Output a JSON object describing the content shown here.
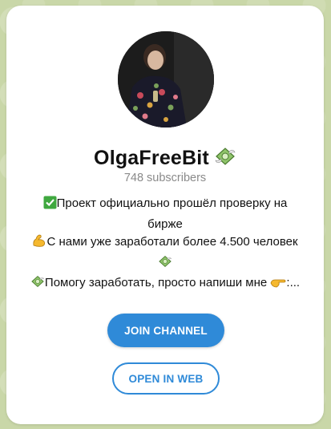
{
  "channel": {
    "name": "OlgaFreeBit",
    "name_emoji_icon": "money-with-wings-icon",
    "subscribers": "748 subscribers",
    "description": {
      "line1_emoji": "check-mark-icon",
      "line1": "Проект официально прошёл проверку на",
      "line2": "бирже",
      "line3_emoji": "flexed-biceps-icon",
      "line3": "С нами уже заработали более 4.500 человек",
      "line4_emoji": "money-with-wings-icon",
      "line5_emoji": "money-with-wings-icon",
      "line5": "Помогу заработать, просто напиши мне",
      "line5_end_emoji": "pointing-right-icon",
      "line5_tail": ":..."
    }
  },
  "buttons": {
    "join": "JOIN CHANNEL",
    "open_web": "OPEN IN WEB"
  },
  "colors": {
    "accent": "#2f8ad8",
    "background": "#c9d7a8",
    "card": "#ffffff",
    "muted_text": "#8a8a8a"
  }
}
